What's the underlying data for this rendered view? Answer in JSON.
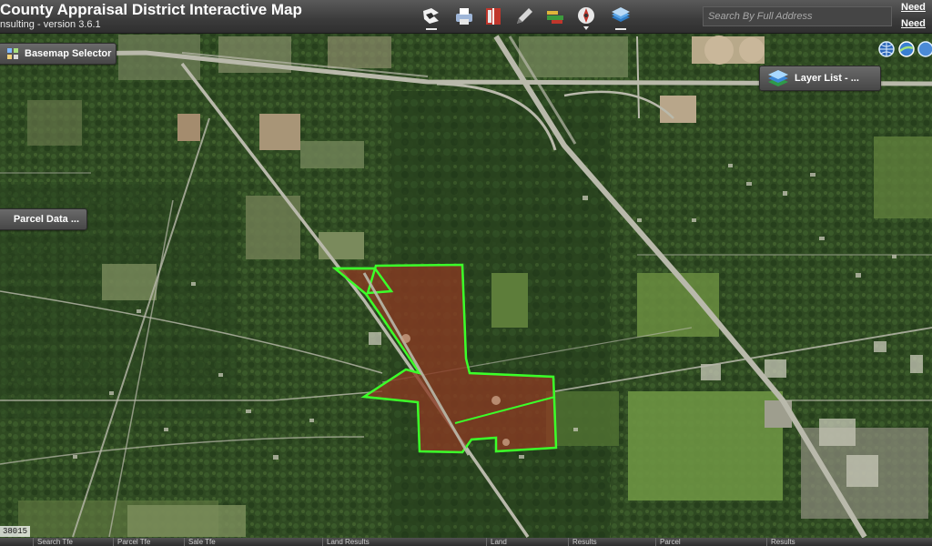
{
  "header": {
    "title": "County Appraisal District Interactive Map",
    "subtitle": "nsulting - version 3.6.1",
    "search_placeholder": "Search By Full Address",
    "help_links": [
      "Need",
      "Need"
    ]
  },
  "toolbar": {
    "tools": [
      {
        "name": "identify-tool-icon"
      },
      {
        "name": "print-tool-icon"
      },
      {
        "name": "bookmark-tool-icon"
      },
      {
        "name": "draw-tool-icon"
      },
      {
        "name": "measure-tool-icon"
      },
      {
        "name": "compass-tool-icon"
      },
      {
        "name": "layers-tool-icon"
      }
    ]
  },
  "widgets": {
    "basemap_selector": "Basemap Selector",
    "layer_list": "Layer List - ...",
    "parcel_data": "Parcel Data ..."
  },
  "footer": {
    "scale_readout": "38015",
    "tabs": [
      "Search Tfe",
      "Parcel Tfe",
      "Sale Tfe",
      "Land Results",
      "Land",
      "Results",
      "Parcel",
      "Results"
    ]
  },
  "map": {
    "parcel_fill": "#8a3a22",
    "parcel_outline": "#3cff2a",
    "vegetation_color": "#2f4a22",
    "road_color": "#b9b9ab"
  }
}
